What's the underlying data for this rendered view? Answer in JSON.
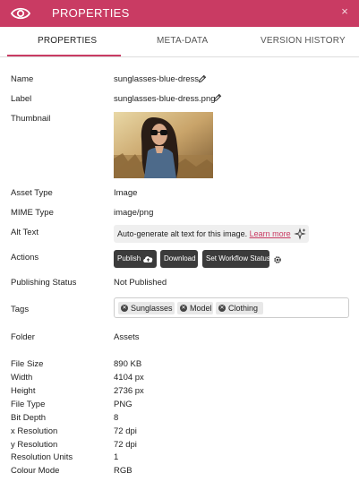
{
  "header": {
    "title": "PROPERTIES",
    "close_glyph": "×",
    "accent": "#c93b63"
  },
  "tabs": [
    {
      "label": "PROPERTIES",
      "active": true
    },
    {
      "label": "META-DATA",
      "active": false
    },
    {
      "label": "VERSION HISTORY",
      "active": false
    }
  ],
  "details": {
    "name_label": "Name",
    "name_value": "sunglasses-blue-dress",
    "label_label": "Label",
    "label_value": "sunglasses-blue-dress.png",
    "thumbnail_label": "Thumbnail",
    "asset_type_label": "Asset Type",
    "asset_type_value": "Image",
    "mime_label": "MIME Type",
    "mime_value": "image/png",
    "alt_label": "Alt Text",
    "alt_text": "Auto-generate alt text for this image.",
    "alt_link": "Learn more",
    "actions_label": "Actions",
    "publish_label": "Publish",
    "download_label": "Download",
    "workflow_label": "Set Workflow Status",
    "publishing_label": "Publishing Status",
    "publishing_value": "Not Published",
    "tags_label": "Tags",
    "tags": [
      "Sunglasses",
      "Model",
      "Clothing"
    ],
    "folder_label": "Folder",
    "folder_value": "Assets"
  },
  "file_info": [
    {
      "label": "File Size",
      "value": "890 KB"
    },
    {
      "label": "Width",
      "value": "4104 px"
    },
    {
      "label": "Height",
      "value": "2736 px"
    },
    {
      "label": "File Type",
      "value": "PNG"
    },
    {
      "label": "Bit Depth",
      "value": "8"
    },
    {
      "label": "x Resolution",
      "value": "72 dpi"
    },
    {
      "label": "y Resolution",
      "value": "72 dpi"
    },
    {
      "label": "Resolution Units",
      "value": "1"
    },
    {
      "label": "Colour Mode",
      "value": "RGB"
    }
  ],
  "icons": [
    "eye-icon",
    "close-icon",
    "pencil-icon",
    "sparkle-icon",
    "cloud-upload-icon",
    "gear-icon",
    "remove-tag-icon"
  ]
}
